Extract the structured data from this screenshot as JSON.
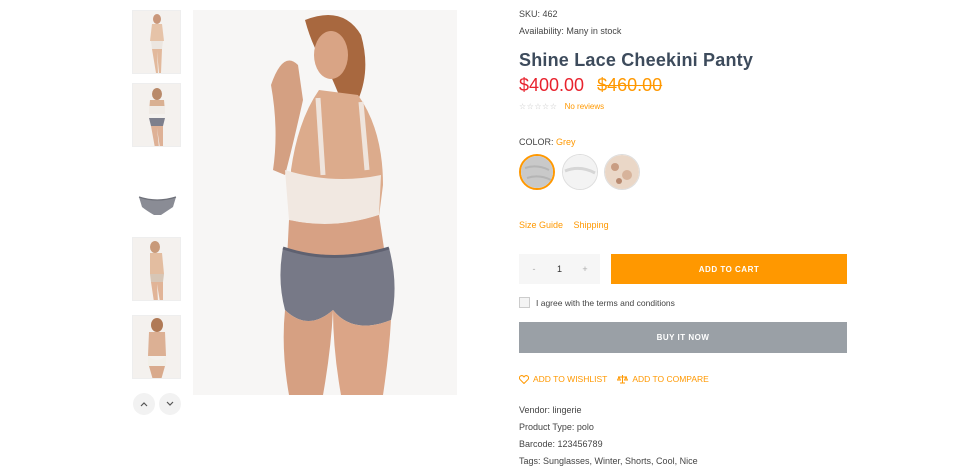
{
  "product": {
    "sku": "SKU: 462",
    "availability": "Availability: Many in stock",
    "title": "Shine Lace Cheekini Panty",
    "price_current": "$400.00",
    "price_old": "$460.00",
    "rating_stars": "☆☆☆☆☆",
    "reviews_label": "No reviews"
  },
  "color": {
    "label": "COLOR:",
    "value": "Grey",
    "swatches": [
      "grey",
      "white",
      "champagne-print"
    ]
  },
  "links": {
    "size_guide": "Size Guide",
    "shipping": "Shipping"
  },
  "cart": {
    "minus": "-",
    "quantity": "1",
    "plus": "+",
    "add_to_cart": "ADD TO CART",
    "terms": "I agree with the terms and conditions",
    "buy_now": "BUY IT NOW"
  },
  "actions": {
    "wishlist": "ADD TO WISHLIST",
    "compare": "ADD TO COMPARE"
  },
  "details": {
    "vendor": "Vendor: lingerie",
    "product_type": "Product Type: polo",
    "barcode": "Barcode: 123456789",
    "tags": "Tags: Sunglasses, Winter, Shorts, Cool, Nice"
  },
  "colors": {
    "accent": "#ff9800",
    "price_red": "#e8232e",
    "title": "#3d4b5c",
    "buy_now_bg": "#9aa0a6"
  },
  "icons": {
    "thumb_prev": "chevron-up-icon",
    "thumb_next": "chevron-down-icon",
    "wishlist": "heart-icon",
    "compare": "compare-icon"
  }
}
